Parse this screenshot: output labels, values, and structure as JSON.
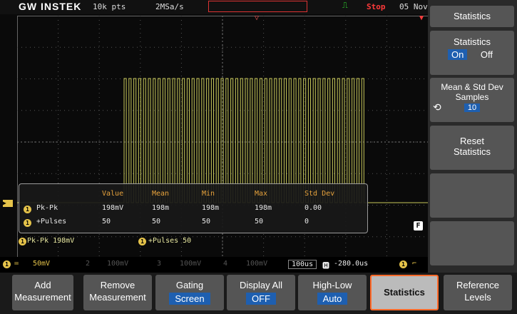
{
  "top": {
    "brand": "GW INSTEK",
    "record": "10k pts",
    "rate": "2MSa/s",
    "status": "Stop",
    "date": "05 Nov"
  },
  "table": {
    "headers": [
      "Value",
      "Mean",
      "Min",
      "Max",
      "Std Dev"
    ],
    "rows": [
      {
        "num": "1",
        "name": "Pk-Pk",
        "value": "198mV",
        "mean": "198m",
        "min": "198m",
        "max": "198m",
        "std": "0.00"
      },
      {
        "num": "1",
        "name": "+Pulses",
        "value": "50",
        "mean": "50",
        "min": "50",
        "max": "50",
        "std": "0"
      }
    ]
  },
  "f_badge": "F",
  "readout": {
    "r1": "Pk-Pk 198mV",
    "r2": "+Pulses 50"
  },
  "channels": {
    "ch1": "1",
    "ch1_scale": "50mV",
    "ch2": "2",
    "ch2_scale": "100mV",
    "ch3": "3",
    "ch3_scale": "100mV",
    "ch4": "4",
    "ch4_scale": "100mV",
    "timebase": "100us",
    "offset": "-280.0us",
    "trig_ch": "1"
  },
  "softkeys": [
    {
      "l1": "Add",
      "l2": "Measurement"
    },
    {
      "l1": "Remove",
      "l2": "Measurement"
    },
    {
      "l1": "Gating",
      "l2": "Screen"
    },
    {
      "l1": "Display All",
      "l2": "OFF"
    },
    {
      "l1": "High-Low",
      "l2": "Auto"
    },
    {
      "l1": "Statistics",
      "l2": ""
    },
    {
      "l1": "Reference",
      "l2": "Levels"
    }
  ],
  "panel": {
    "title": "Statistics",
    "stats_label": "Statistics",
    "on": "On",
    "off": "Off",
    "mean_l1": "Mean & Std Dev",
    "mean_l2": "Samples",
    "mean_val": "10",
    "reset_l1": "Reset",
    "reset_l2": "Statistics"
  },
  "colors": {
    "ch1": "#e5c34a",
    "trace": "#c8c85a",
    "accent": "#ff6a2a",
    "selected": "#1e5fb0"
  }
}
